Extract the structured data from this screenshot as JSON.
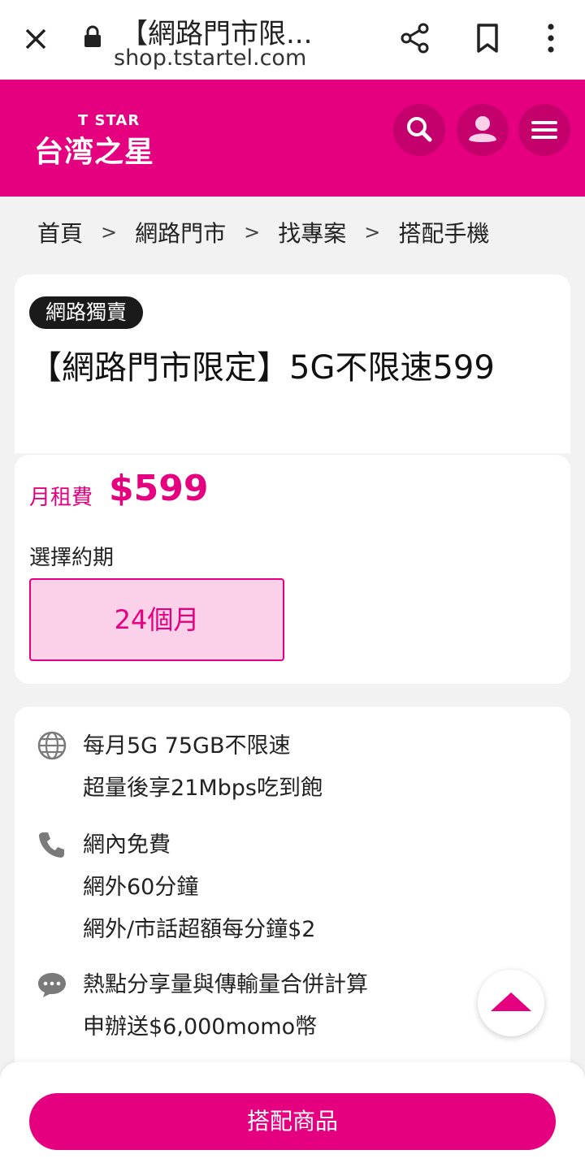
{
  "browser": {
    "title": "【網路門市限...",
    "url": "shop.tstartel.com"
  },
  "header": {
    "logo_en": "T STAR",
    "logo_zh": "台湾之星",
    "brand_color": "#e4007f"
  },
  "breadcrumb": [
    "首頁",
    "網路門市",
    "找專案",
    "搭配手機"
  ],
  "product": {
    "badge": "網路獨賣",
    "title": "【網路門市限定】5G不限速599",
    "price_label": "月租費",
    "price": "$599",
    "period_label": "選擇約期",
    "period_option": "24個月"
  },
  "features": [
    {
      "icon": "globe-icon",
      "lines": [
        "每月5G 75GB不限速",
        "超量後享21Mbps吃到飽"
      ]
    },
    {
      "icon": "phone-icon",
      "lines": [
        "網內免費",
        "網外60分鐘",
        "網外/市話超額每分鐘$2"
      ]
    },
    {
      "icon": "chat-icon",
      "lines": [
        "熱點分享量與傳輸量合併計算",
        "申辦送$6,000momo幣"
      ]
    }
  ],
  "cta_label": "搭配商品"
}
